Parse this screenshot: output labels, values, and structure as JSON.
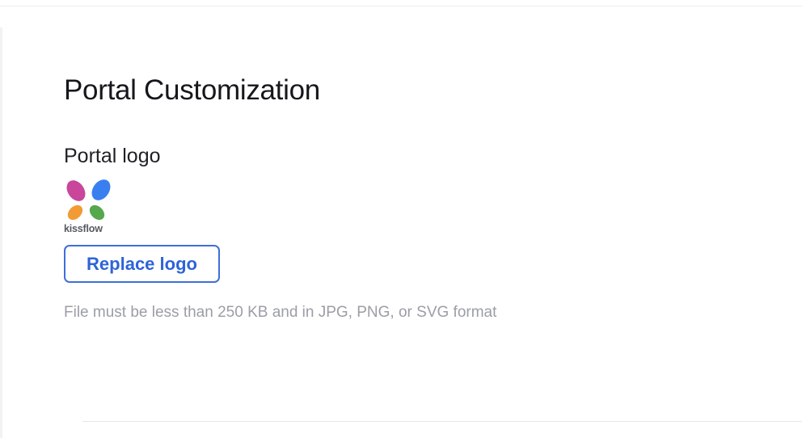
{
  "page": {
    "title": "Portal Customization"
  },
  "portal_logo": {
    "section_title": "Portal logo",
    "logo_text": "kissflow",
    "logo_icon": "kissflow-butterfly-icon",
    "replace_button_label": "Replace logo",
    "hint": "File must be less than 250 KB and in JPG, PNG, or SVG format"
  },
  "colors": {
    "accent": "#2e64d7",
    "hint_text": "#9a9ea6",
    "logo_pink": "#c9469a",
    "logo_blue": "#3a7ff0",
    "logo_orange": "#f29b34",
    "logo_green": "#55a84c"
  }
}
